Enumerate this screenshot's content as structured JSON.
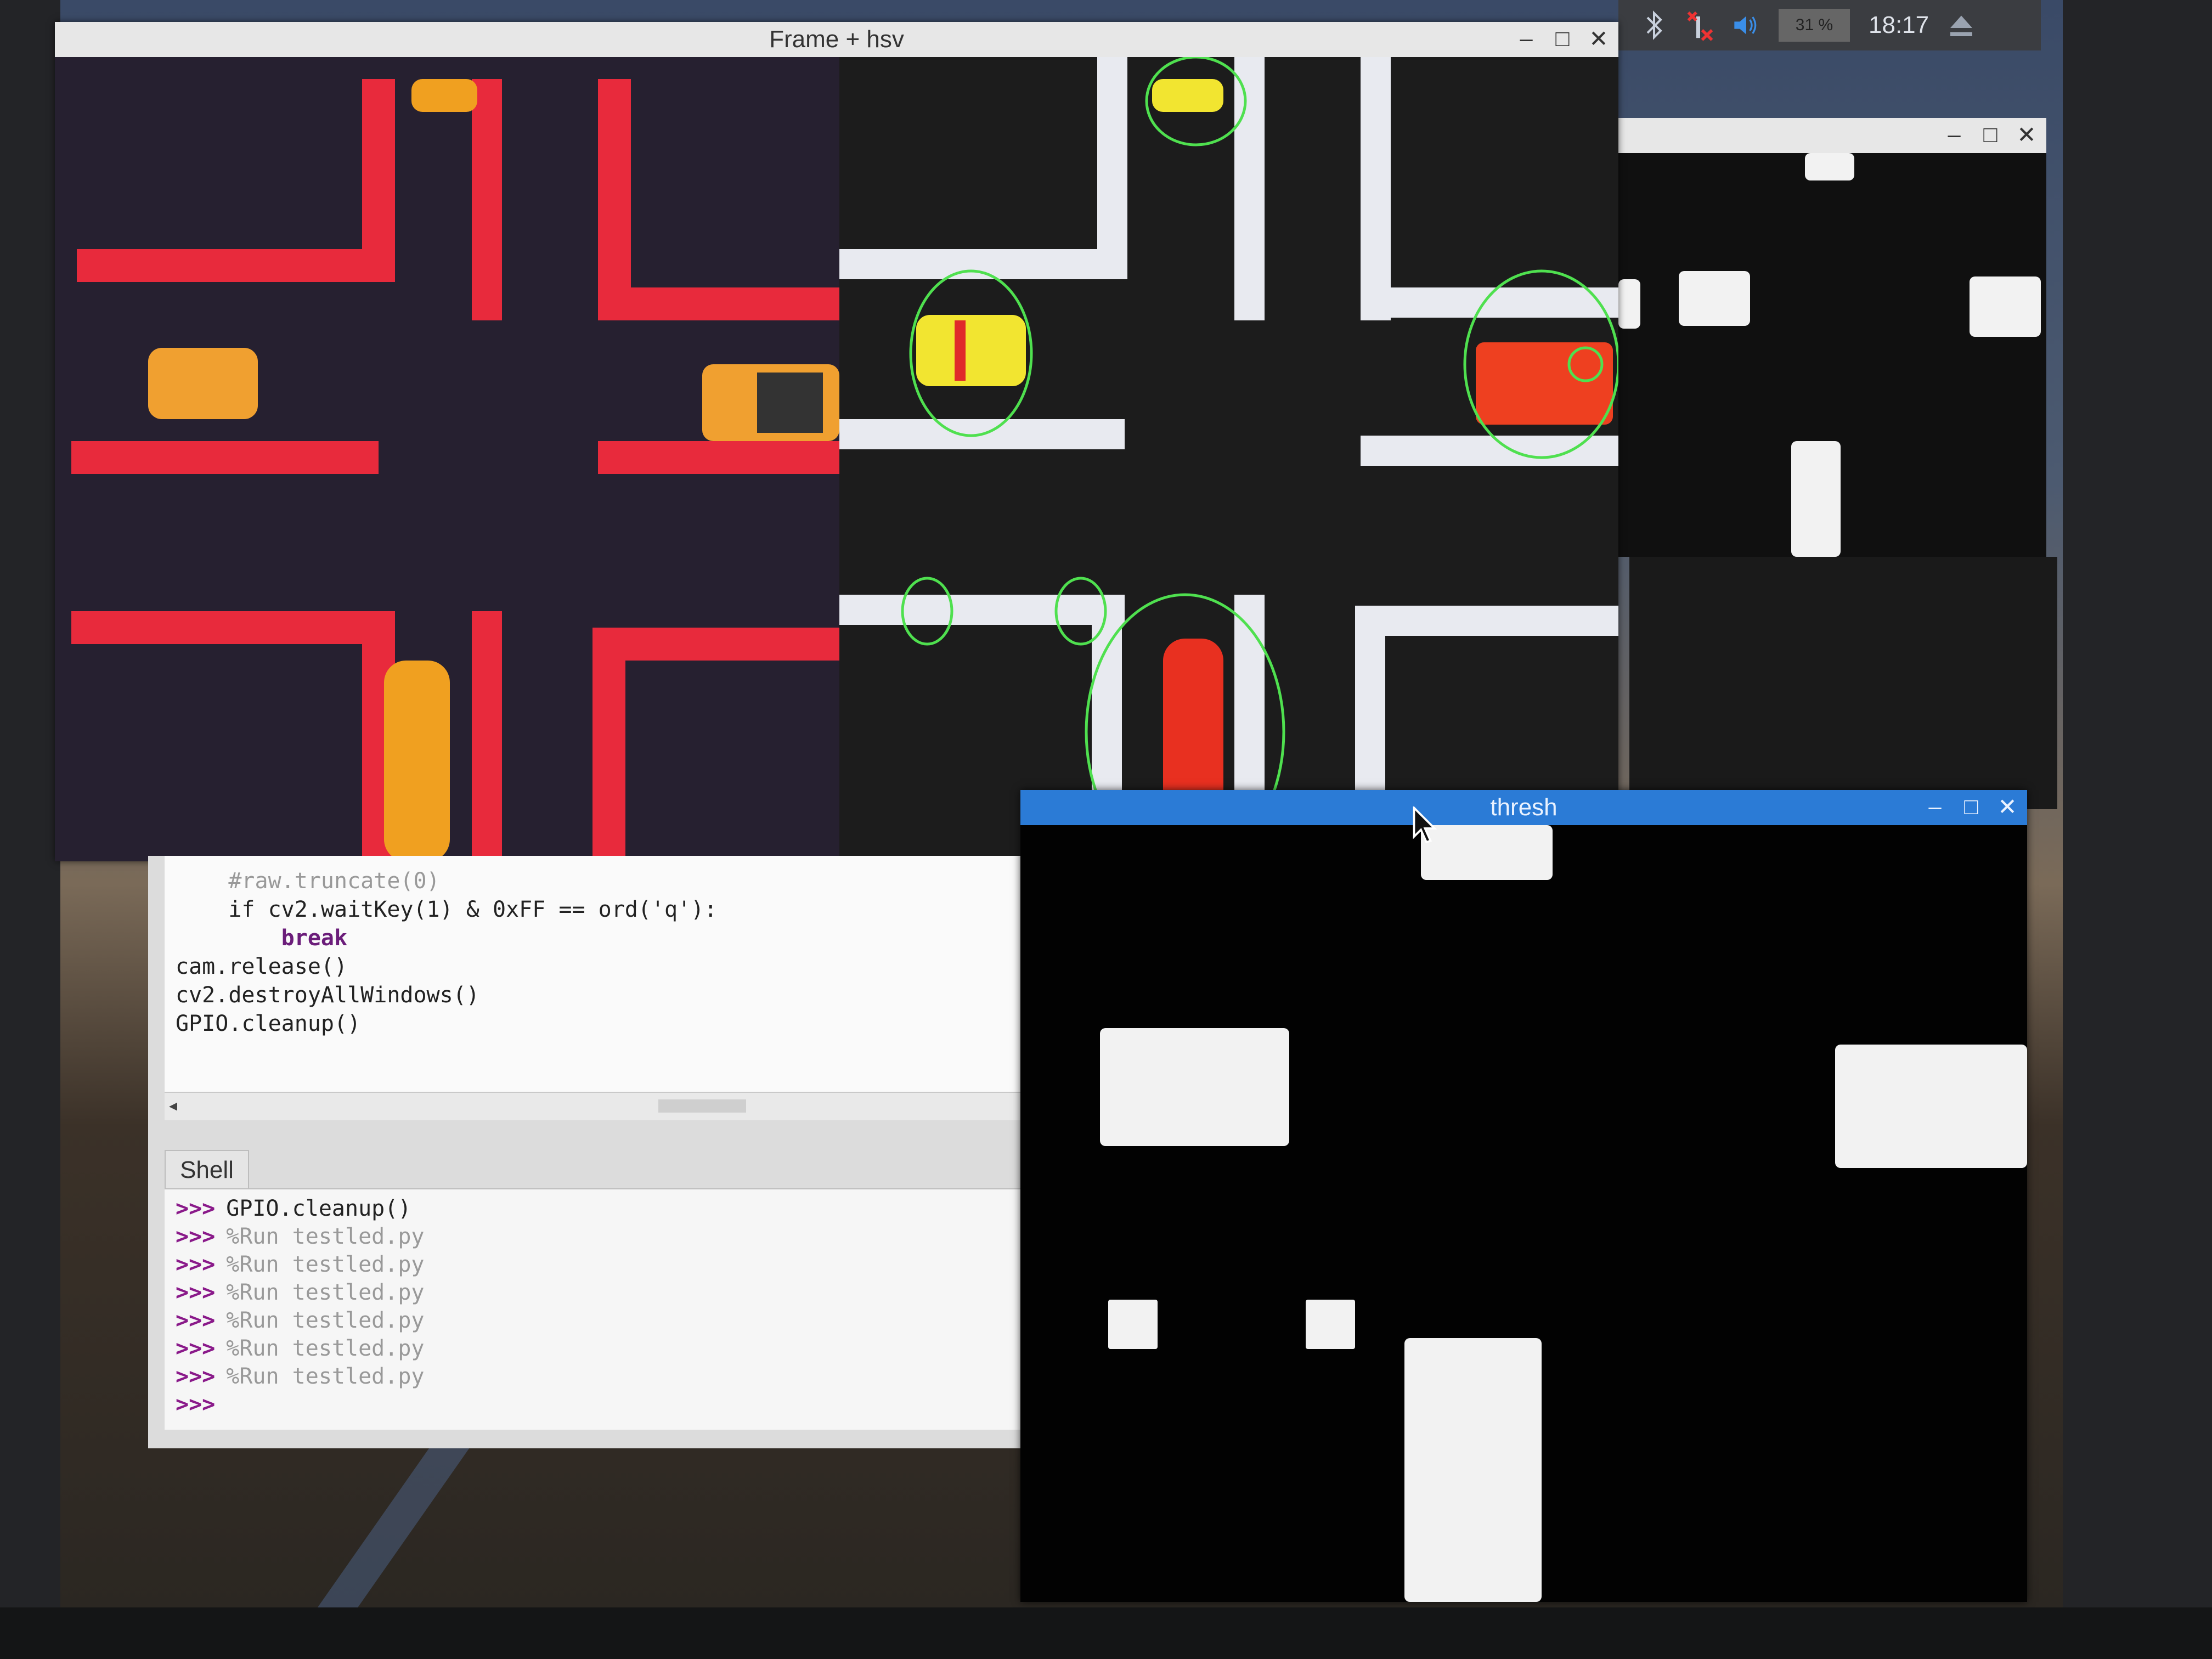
{
  "frame_window": {
    "title": "Frame + hsv",
    "controls": [
      "–",
      "□",
      "✕"
    ]
  },
  "small_window": {
    "controls": [
      "–",
      "□",
      "✕"
    ]
  },
  "panel": {
    "battery_percent": "31 %",
    "clock": "18:17"
  },
  "editor": {
    "lines": [
      "    #raw.truncate(0)",
      "    if cv2.waitKey(1) & 0xFF == ord('q'):",
      "        break",
      "",
      "cam.release()",
      "cv2.destroyAllWindows()",
      "GPIO.cleanup()"
    ]
  },
  "shell": {
    "tab_label": "Shell",
    "prompt": ">>>",
    "history": [
      "GPIO.cleanup()",
      "%Run testled.py",
      "%Run testled.py",
      "%Run testled.py",
      "%Run testled.py",
      "%Run testled.py",
      "%Run testled.py"
    ]
  },
  "thresh_window": {
    "title": "thresh",
    "controls": [
      "–",
      "□",
      "✕"
    ]
  },
  "icons": {
    "bluetooth": "bluetooth-icon",
    "network": "network-disconnected-icon",
    "volume": "volume-icon",
    "eject": "eject-icon"
  }
}
